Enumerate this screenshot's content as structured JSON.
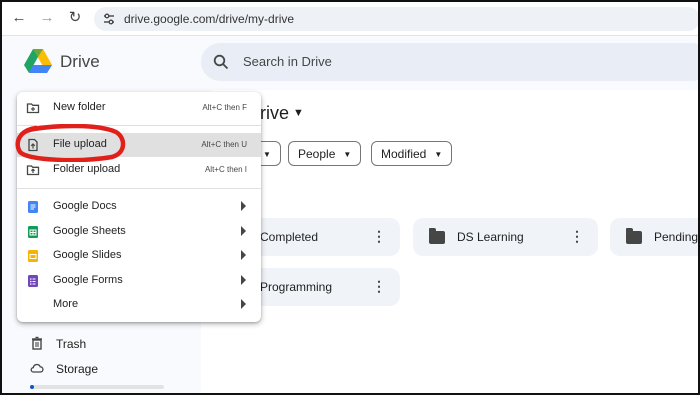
{
  "browser": {
    "url": "drive.google.com/drive/my-drive"
  },
  "header": {
    "app_name": "Drive",
    "search_placeholder": "Search in Drive"
  },
  "main": {
    "title_partial": "rive",
    "filters": [
      "People",
      "Modified"
    ],
    "folders": [
      "Completed",
      "DS Learning",
      "Pending",
      "Programming"
    ]
  },
  "sidebar": {
    "items": [
      "Trash",
      "Storage"
    ]
  },
  "new_menu": {
    "items": [
      {
        "label": "New folder",
        "shortcut": "Alt+C then F"
      },
      {
        "label": "File upload",
        "shortcut": "Alt+C then U"
      },
      {
        "label": "Folder upload",
        "shortcut": "Alt+C then I"
      },
      {
        "label": "Google Docs"
      },
      {
        "label": "Google Sheets"
      },
      {
        "label": "Google Slides"
      },
      {
        "label": "Google Forms"
      },
      {
        "label": "More"
      }
    ]
  },
  "colors": {
    "docs": "#4285f4",
    "sheets": "#0f9d58",
    "slides": "#f4b400",
    "forms": "#7248b9",
    "annotation": "#e0201b",
    "highlight": "#e0e0e0"
  }
}
